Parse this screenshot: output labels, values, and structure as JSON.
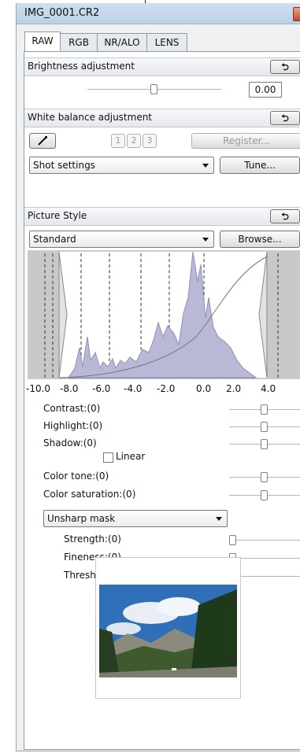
{
  "window": {
    "title": "IMG_0001.CR2"
  },
  "tabs": [
    {
      "label": "RAW"
    },
    {
      "label": "RGB"
    },
    {
      "label": "NR/ALO"
    },
    {
      "label": "LENS"
    }
  ],
  "brightness": {
    "header": "Brightness adjustment",
    "reset": "⮌",
    "value": "0.00"
  },
  "white_balance": {
    "header": "White balance adjustment",
    "reset": "⮌",
    "slot1": "1",
    "slot2": "2",
    "slot3": "3",
    "register": "Register...",
    "selected": "Shot settings",
    "tune": "Tune..."
  },
  "picture_style": {
    "header": "Picture Style",
    "reset": "⮌",
    "selected": "Standard",
    "browse": "Browse...",
    "axis_ticks": [
      "-10.0",
      "-8.0",
      "-6.0",
      "-4.0",
      "-2.0",
      "0.0",
      "2.0",
      "4.0"
    ]
  },
  "sliders": {
    "contrast": "Contrast:(0)",
    "highlight": "Highlight:(0)",
    "shadow": "Shadow:(0)",
    "linear": "Linear",
    "color_tone": "Color tone:(0)",
    "color_saturation": "Color saturation:(0)"
  },
  "sharpness": {
    "selected": "Unsharp mask",
    "strength": "Strength:(0)",
    "fineness": "Fineness:(0)",
    "threshold": "Threshold:(0)"
  },
  "colors": {
    "accent": "#3b7bd6",
    "histogram": "#b9b8d6",
    "panel_border": "#8e9bab"
  }
}
